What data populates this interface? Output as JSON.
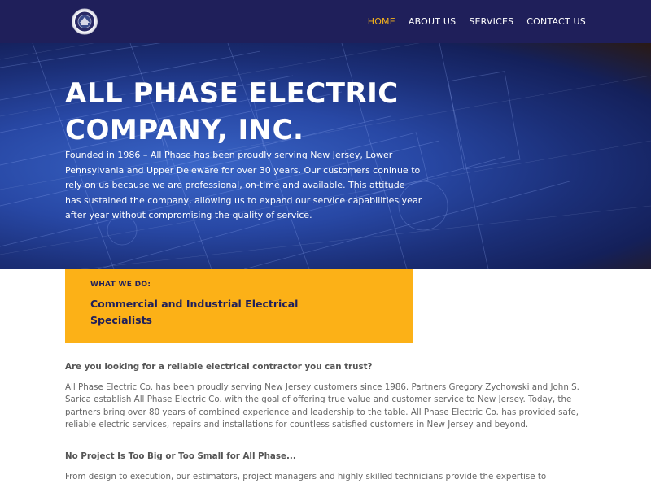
{
  "header": {
    "logo_name": "all-phase-electric-logo",
    "nav": [
      {
        "label": "HOME",
        "active": true
      },
      {
        "label": "ABOUT US",
        "active": false
      },
      {
        "label": "SERVICES",
        "active": false
      },
      {
        "label": "CONTACT US",
        "active": false
      }
    ]
  },
  "hero": {
    "title": "ALL PHASE ELECTRIC\nCOMPANY, INC.",
    "text": "Founded in 1986 – All Phase has been proudly serving New Jersey, Lower Pennsylvania and Upper Deleware for over 30 years.  Our customers coninue to rely on us because we are professional, on-time and available. This attitude has sustained the company, allowing us to expand our service capabilities year after year without compromising the quality of service."
  },
  "what_we_do": {
    "label": "WHAT WE DO:",
    "title": "Commercial and Industrial Electrical\nSpecialists"
  },
  "content": {
    "question1": "Are you looking for a reliable electrical contractor you can trust?",
    "paragraph1": "All Phase Electric Co. has been proudly serving New Jersey customers since 1986. Partners Gregory Zychowski and John S. Sarica establish All Phase Electric Co. with the goal of offering true value and customer service to New Jersey. Today, the partners bring over 80 years of combined experience and leadership to the table.  All Phase Electric Co. has provided safe, reliable electric services, repairs and installations for countless satisfied customers in New Jersey and beyond.",
    "question2": "No Project Is Too Big or Too Small for All Phase...",
    "paragraph2": "From design to execution, our estimators, project managers and highly skilled technicians provide the expertise to"
  },
  "colors": {
    "header_bg": "#1f1f5a",
    "accent": "#f5b21b",
    "box_bg": "#fcb117",
    "hero_blue": "#2848a5"
  }
}
